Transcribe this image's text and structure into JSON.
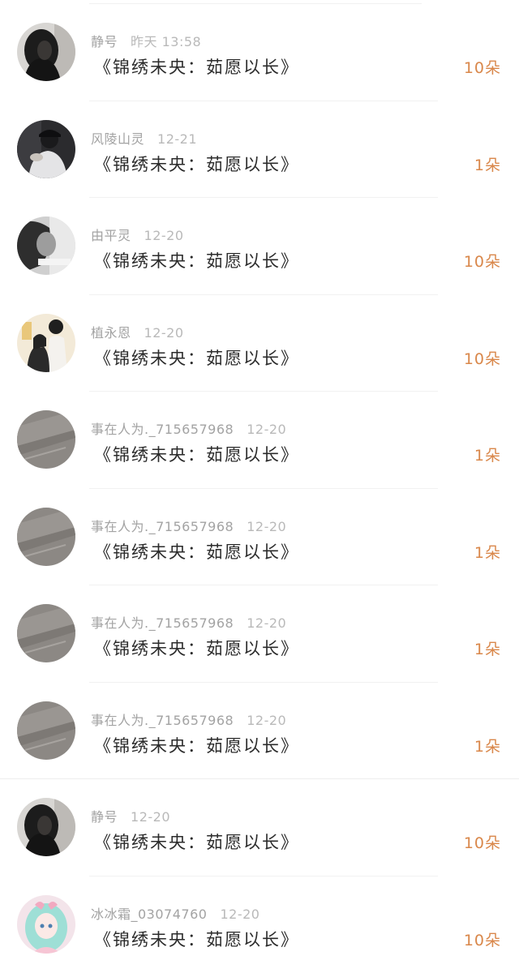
{
  "rows": [
    {
      "user": "静号",
      "date": "昨天 13:58",
      "title": "《锦绣未央：茹愿以长》",
      "amount": "10朵",
      "avatar_icon": "dark-hair-portrait-avatar"
    },
    {
      "user": "风陵山灵",
      "date": "12-21",
      "title": "《锦绣未央：茹愿以长》",
      "amount": "1朵",
      "avatar_icon": "person-with-cap-avatar"
    },
    {
      "user": "由平灵",
      "date": "12-20",
      "title": "《锦绣未央：茹愿以长》",
      "amount": "10朵",
      "avatar_icon": "grayscale-portrait-avatar"
    },
    {
      "user": "植永恩",
      "date": "12-20",
      "title": "《锦绣未央：茹愿以长》",
      "amount": "10朵",
      "avatar_icon": "illustrated-couple-avatar"
    },
    {
      "user": "事在人为._715657968",
      "date": "12-20",
      "title": "《锦绣未央：茹愿以长》",
      "amount": "1朵",
      "avatar_icon": "gray-texture-avatar"
    },
    {
      "user": "事在人为._715657968",
      "date": "12-20",
      "title": "《锦绣未央：茹愿以长》",
      "amount": "1朵",
      "avatar_icon": "gray-texture-avatar"
    },
    {
      "user": "事在人为._715657968",
      "date": "12-20",
      "title": "《锦绣未央：茹愿以长》",
      "amount": "1朵",
      "avatar_icon": "gray-texture-avatar"
    },
    {
      "user": "事在人为._715657968",
      "date": "12-20",
      "title": "《锦绣未央：茹愿以长》",
      "amount": "1朵",
      "avatar_icon": "gray-texture-avatar"
    },
    {
      "user": "静号",
      "date": "12-20",
      "title": "《锦绣未央：茹愿以长》",
      "amount": "10朵",
      "avatar_icon": "dark-hair-portrait-avatar"
    },
    {
      "user": "冰冰霜_03074760",
      "date": "12-20",
      "title": "《锦绣未央：茹愿以长》",
      "amount": "10朵",
      "avatar_icon": "anime-girl-avatar"
    }
  ],
  "colors": {
    "amount": "#d9874a",
    "title": "#2b2b2b",
    "meta": "#a3a3a3"
  }
}
